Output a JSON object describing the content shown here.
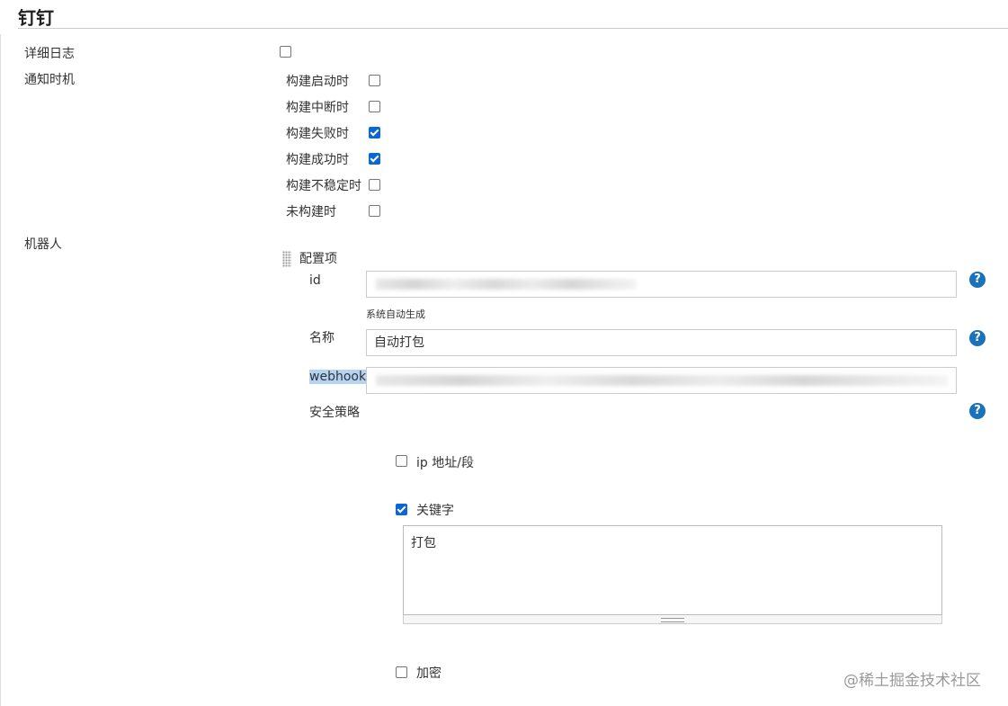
{
  "section": {
    "title": "钉钉"
  },
  "verbose_log": {
    "label": "详细日志",
    "checked": false
  },
  "notify": {
    "label": "通知时机",
    "options": [
      {
        "label": "构建启动时",
        "checked": false
      },
      {
        "label": "构建中断时",
        "checked": false
      },
      {
        "label": "构建失败时",
        "checked": true
      },
      {
        "label": "构建成功时",
        "checked": true
      },
      {
        "label": "构建不稳定时",
        "checked": false
      },
      {
        "label": "未构建时",
        "checked": false
      }
    ]
  },
  "robot": {
    "label": "机器人",
    "config_title": "配置项",
    "id_label": "id",
    "id_hint": "系统自动生成",
    "name_label": "名称",
    "name_value": "自动打包",
    "webhook_label": "webhook",
    "security_label": "安全策略",
    "security": {
      "ip": {
        "label": "ip 地址/段",
        "checked": false
      },
      "keyword": {
        "label": "关键字",
        "checked": true,
        "value": "打包"
      },
      "encrypt": {
        "label": "加密",
        "checked": false
      }
    },
    "help_icon": "?"
  },
  "watermark": "@稀土掘金技术社区",
  "colors": {
    "accent": "#0a65d8",
    "help": "#1a73b8",
    "highlight": "#b5d4f5"
  }
}
